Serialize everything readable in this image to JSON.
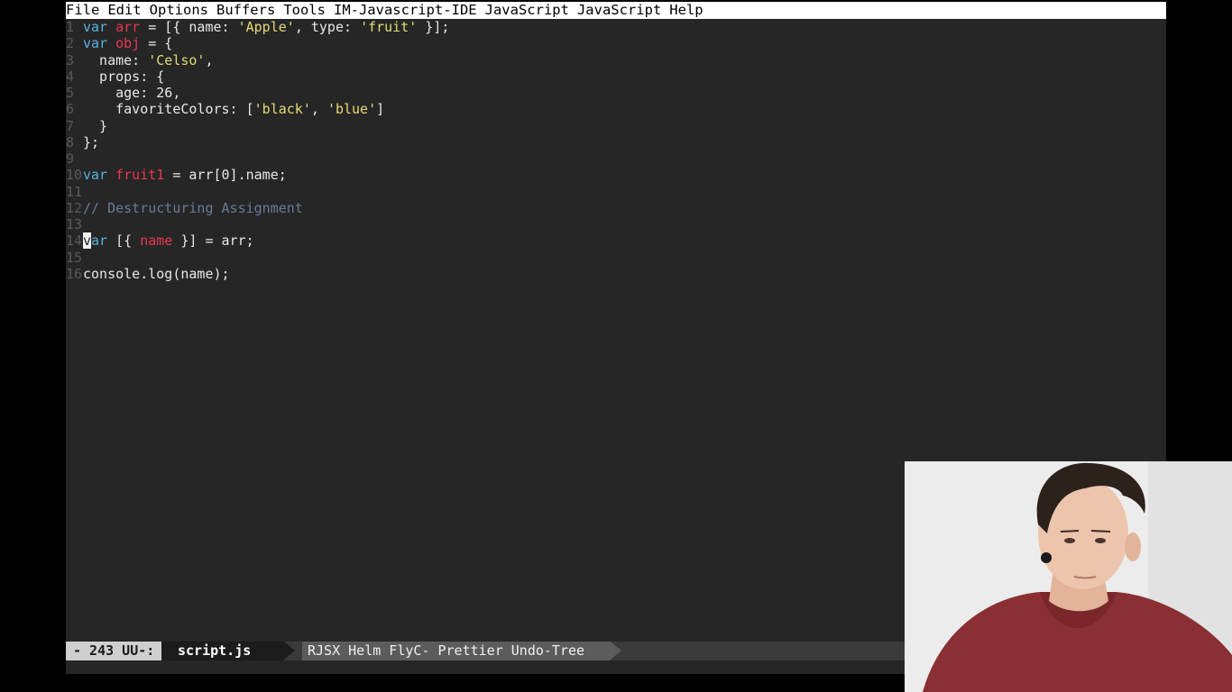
{
  "menubar": {
    "items": [
      "File",
      "Edit",
      "Options",
      "Buffers",
      "Tools",
      "IM-Javascript-IDE",
      "JavaScript",
      "JavaScript",
      "Help"
    ]
  },
  "editor": {
    "lines": [
      {
        "num": "1",
        "tokens": [
          [
            "keyword",
            "var"
          ],
          [
            "plain",
            " "
          ],
          [
            "varname",
            "arr"
          ],
          [
            "plain",
            " = [{ name: "
          ],
          [
            "string",
            "'Apple'"
          ],
          [
            "plain",
            ", type: "
          ],
          [
            "string",
            "'fruit'"
          ],
          [
            "plain",
            " }];"
          ]
        ]
      },
      {
        "num": "2",
        "tokens": [
          [
            "keyword",
            "var"
          ],
          [
            "plain",
            " "
          ],
          [
            "varname",
            "obj"
          ],
          [
            "plain",
            " = {"
          ]
        ]
      },
      {
        "num": "3",
        "tokens": [
          [
            "plain",
            "  name: "
          ],
          [
            "string",
            "'Celso'"
          ],
          [
            "plain",
            ","
          ]
        ]
      },
      {
        "num": "4",
        "tokens": [
          [
            "plain",
            "  props: {"
          ]
        ]
      },
      {
        "num": "5",
        "tokens": [
          [
            "plain",
            "    age: 26,"
          ]
        ]
      },
      {
        "num": "6",
        "tokens": [
          [
            "plain",
            "    favoriteColors: ["
          ],
          [
            "string",
            "'black'"
          ],
          [
            "plain",
            ", "
          ],
          [
            "string",
            "'blue'"
          ],
          [
            "plain",
            "]"
          ]
        ]
      },
      {
        "num": "7",
        "tokens": [
          [
            "plain",
            "  }"
          ]
        ]
      },
      {
        "num": "8",
        "tokens": [
          [
            "plain",
            "};"
          ]
        ]
      },
      {
        "num": "9",
        "tokens": []
      },
      {
        "num": "10",
        "tokens": [
          [
            "keyword",
            "var"
          ],
          [
            "plain",
            " "
          ],
          [
            "varname",
            "fruit1"
          ],
          [
            "plain",
            " = arr[0].name;"
          ]
        ]
      },
      {
        "num": "11",
        "tokens": []
      },
      {
        "num": "12",
        "tokens": [
          [
            "comment",
            "// Destructuring Assignment"
          ]
        ]
      },
      {
        "num": "13",
        "tokens": []
      },
      {
        "num": "14",
        "tokens": [
          [
            "cursor",
            "v"
          ],
          [
            "keyword",
            "ar"
          ],
          [
            "plain",
            " [{ "
          ],
          [
            "varname",
            "name"
          ],
          [
            "plain",
            " }] = arr;"
          ]
        ]
      },
      {
        "num": "15",
        "tokens": []
      },
      {
        "num": "16",
        "tokens": [
          [
            "plain",
            "console.log(name);"
          ]
        ]
      }
    ]
  },
  "modeline": {
    "state": "- 243 UU-:",
    "buffer_name": "script.js",
    "minor_modes": "RJSX Helm FlyC- Prettier Undo-Tree"
  },
  "colors": {
    "background": "#262626",
    "keyword": "#58b2e0",
    "varname": "#e8384f",
    "string": "#e6db74",
    "comment": "#6d7a96",
    "line_number": "#555a5e"
  },
  "webcam": {
    "icon": "person-video-overlay"
  }
}
